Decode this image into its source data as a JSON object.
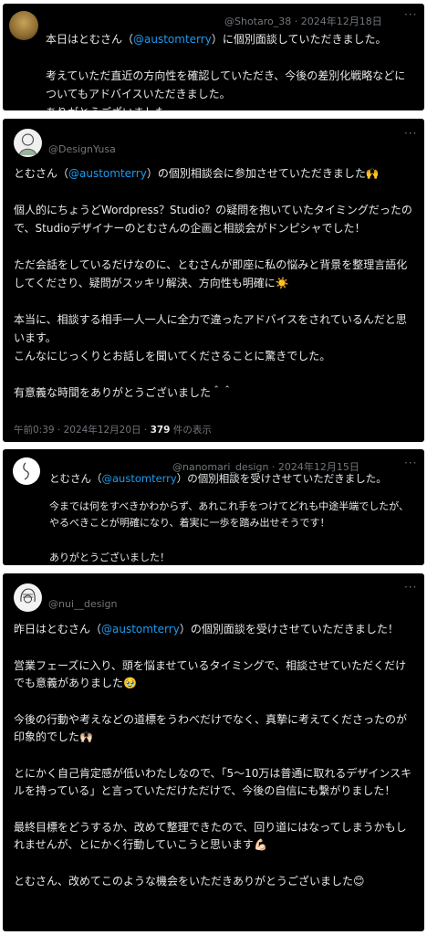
{
  "posts": [
    {
      "handle": "@Shotaro_38 · 2024年12月18日",
      "lines": [
        [
          "本日はとむさん（",
          "@austomterry",
          "）に個別面談していただきました。"
        ],
        "",
        [
          "考えていただ直近の方向性を確認していただき、今後の差別化戦略などについてもアドバイスいただきました。"
        ],
        [
          "ありがとうございました。"
        ]
      ]
    },
    {
      "handle": "@DesignYusa",
      "lines": [
        [
          "とむさん（",
          "@austomterry",
          "）の個別相談会に参加させていただきました🙌"
        ],
        "",
        [
          "個人的にちょうどWordpress？Studio？の疑問を抱いていたタイミングだったので、Studioデザイナーのとむさんの企画と相談会がドンピシャでした！"
        ],
        "",
        [
          "ただ会話をしているだけなのに、とむさんが即座に私の悩みと背景を整理言語化してくださり、疑問がスッキリ解決、方向性も明確に☀️"
        ],
        "",
        [
          "本当に、相談する相手一人一人に全力で違ったアドバイスをされているんだと思います。"
        ],
        [
          "こんなにじっくりとお話しを聞いてくださることに驚きでした。"
        ],
        "",
        [
          "有意義な時間をありがとうございました＾＾"
        ]
      ],
      "meta_prefix": "午前0:39 · 2024年12月20日 · ",
      "views": "379",
      "views_suffix": " 件の表示"
    },
    {
      "handle": "@nanomari_design · 2024年12月15日",
      "lines": [
        [
          "とむさん（",
          "@austomterry",
          "）の個別相談を受けさせていただきました。"
        ]
      ],
      "lines2": [
        [
          "今までは何をすべきかわからず、あれこれ手をつけてどれも中途半端でしたが、やるべきことが明確になり、着実に一歩を踏み出せそうです！"
        ],
        "",
        [
          "ありがとうございました！"
        ]
      ]
    },
    {
      "handle": "@nui__design",
      "lines": [
        [
          "昨日はとむさん（",
          "@austomterry",
          "）の個別面談を受けさせていただきました！"
        ],
        "",
        [
          "営業フェーズに入り、頭を悩ませているタイミングで、相談させていただくだけでも意義がありました🥹"
        ],
        "",
        [
          "今後の行動や考えなどの道標をうわべだけでなく、真摯に考えてくださったのが印象的でした🙌🏻"
        ],
        "",
        [
          "とにかく自己肯定感が低いわたしなので、「5〜10万は普通に取れるデザインスキルを持っている」と言っていただけただけで、今後の自信にも繋がりました！"
        ],
        "",
        [
          "最終目標をどうするか、改めて整理できたので、回り道にはなってしまうかもしれませんが、とにかく行動していこうと思います💪🏻"
        ],
        "",
        [
          "とむさん、改めてこのような機会をいただきありがとうございました😊"
        ]
      ]
    }
  ],
  "more_label": "···",
  "colors": {
    "background": "#000000",
    "text": "#e7e9ea",
    "muted": "#71767b",
    "mention": "#1d9bf0"
  }
}
